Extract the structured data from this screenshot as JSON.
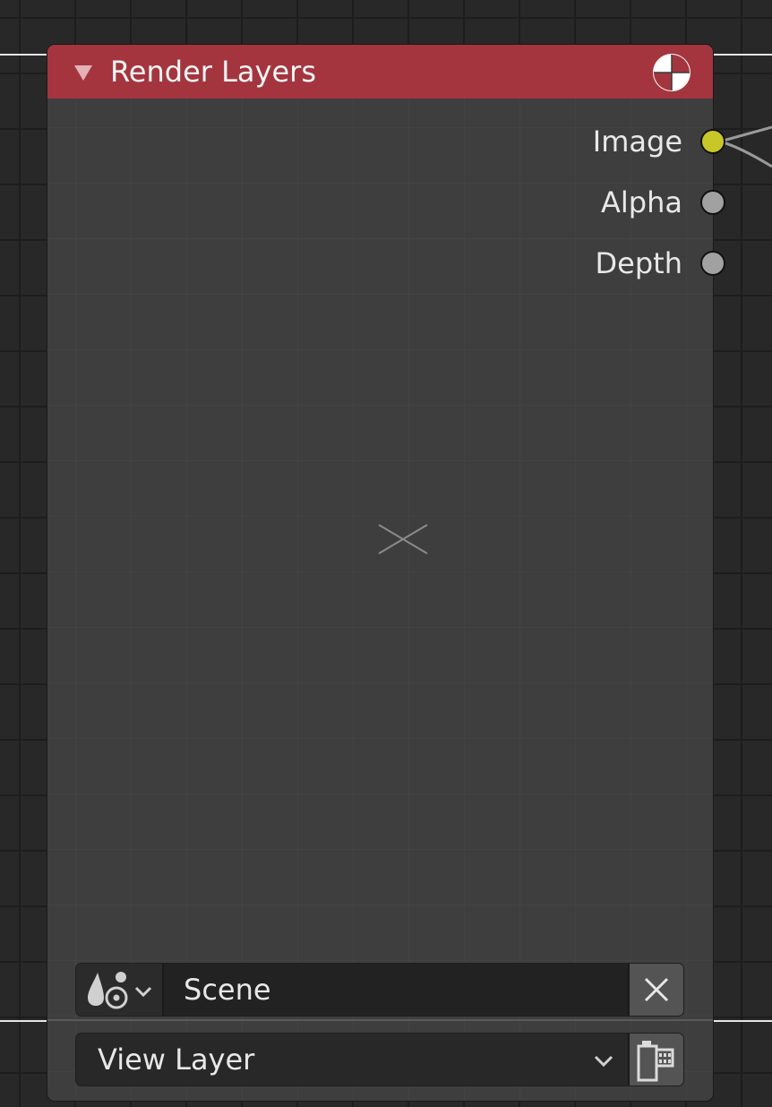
{
  "node": {
    "title": "Render Layers",
    "header_color": "#a4353f",
    "icons": {
      "collapse": "triangle-down-icon",
      "header": "render-result-icon"
    }
  },
  "outputs": [
    {
      "label": "Image",
      "socket_color": "#c7c729"
    },
    {
      "label": "Alpha",
      "socket_color": "#a1a1a1"
    },
    {
      "label": "Depth",
      "socket_color": "#a1a1a1"
    }
  ],
  "scene": {
    "value": "Scene",
    "icon": "scene-icon",
    "clear_icon": "close-icon"
  },
  "view_layer": {
    "value": "View Layer",
    "icon": "view-layer-icon"
  }
}
